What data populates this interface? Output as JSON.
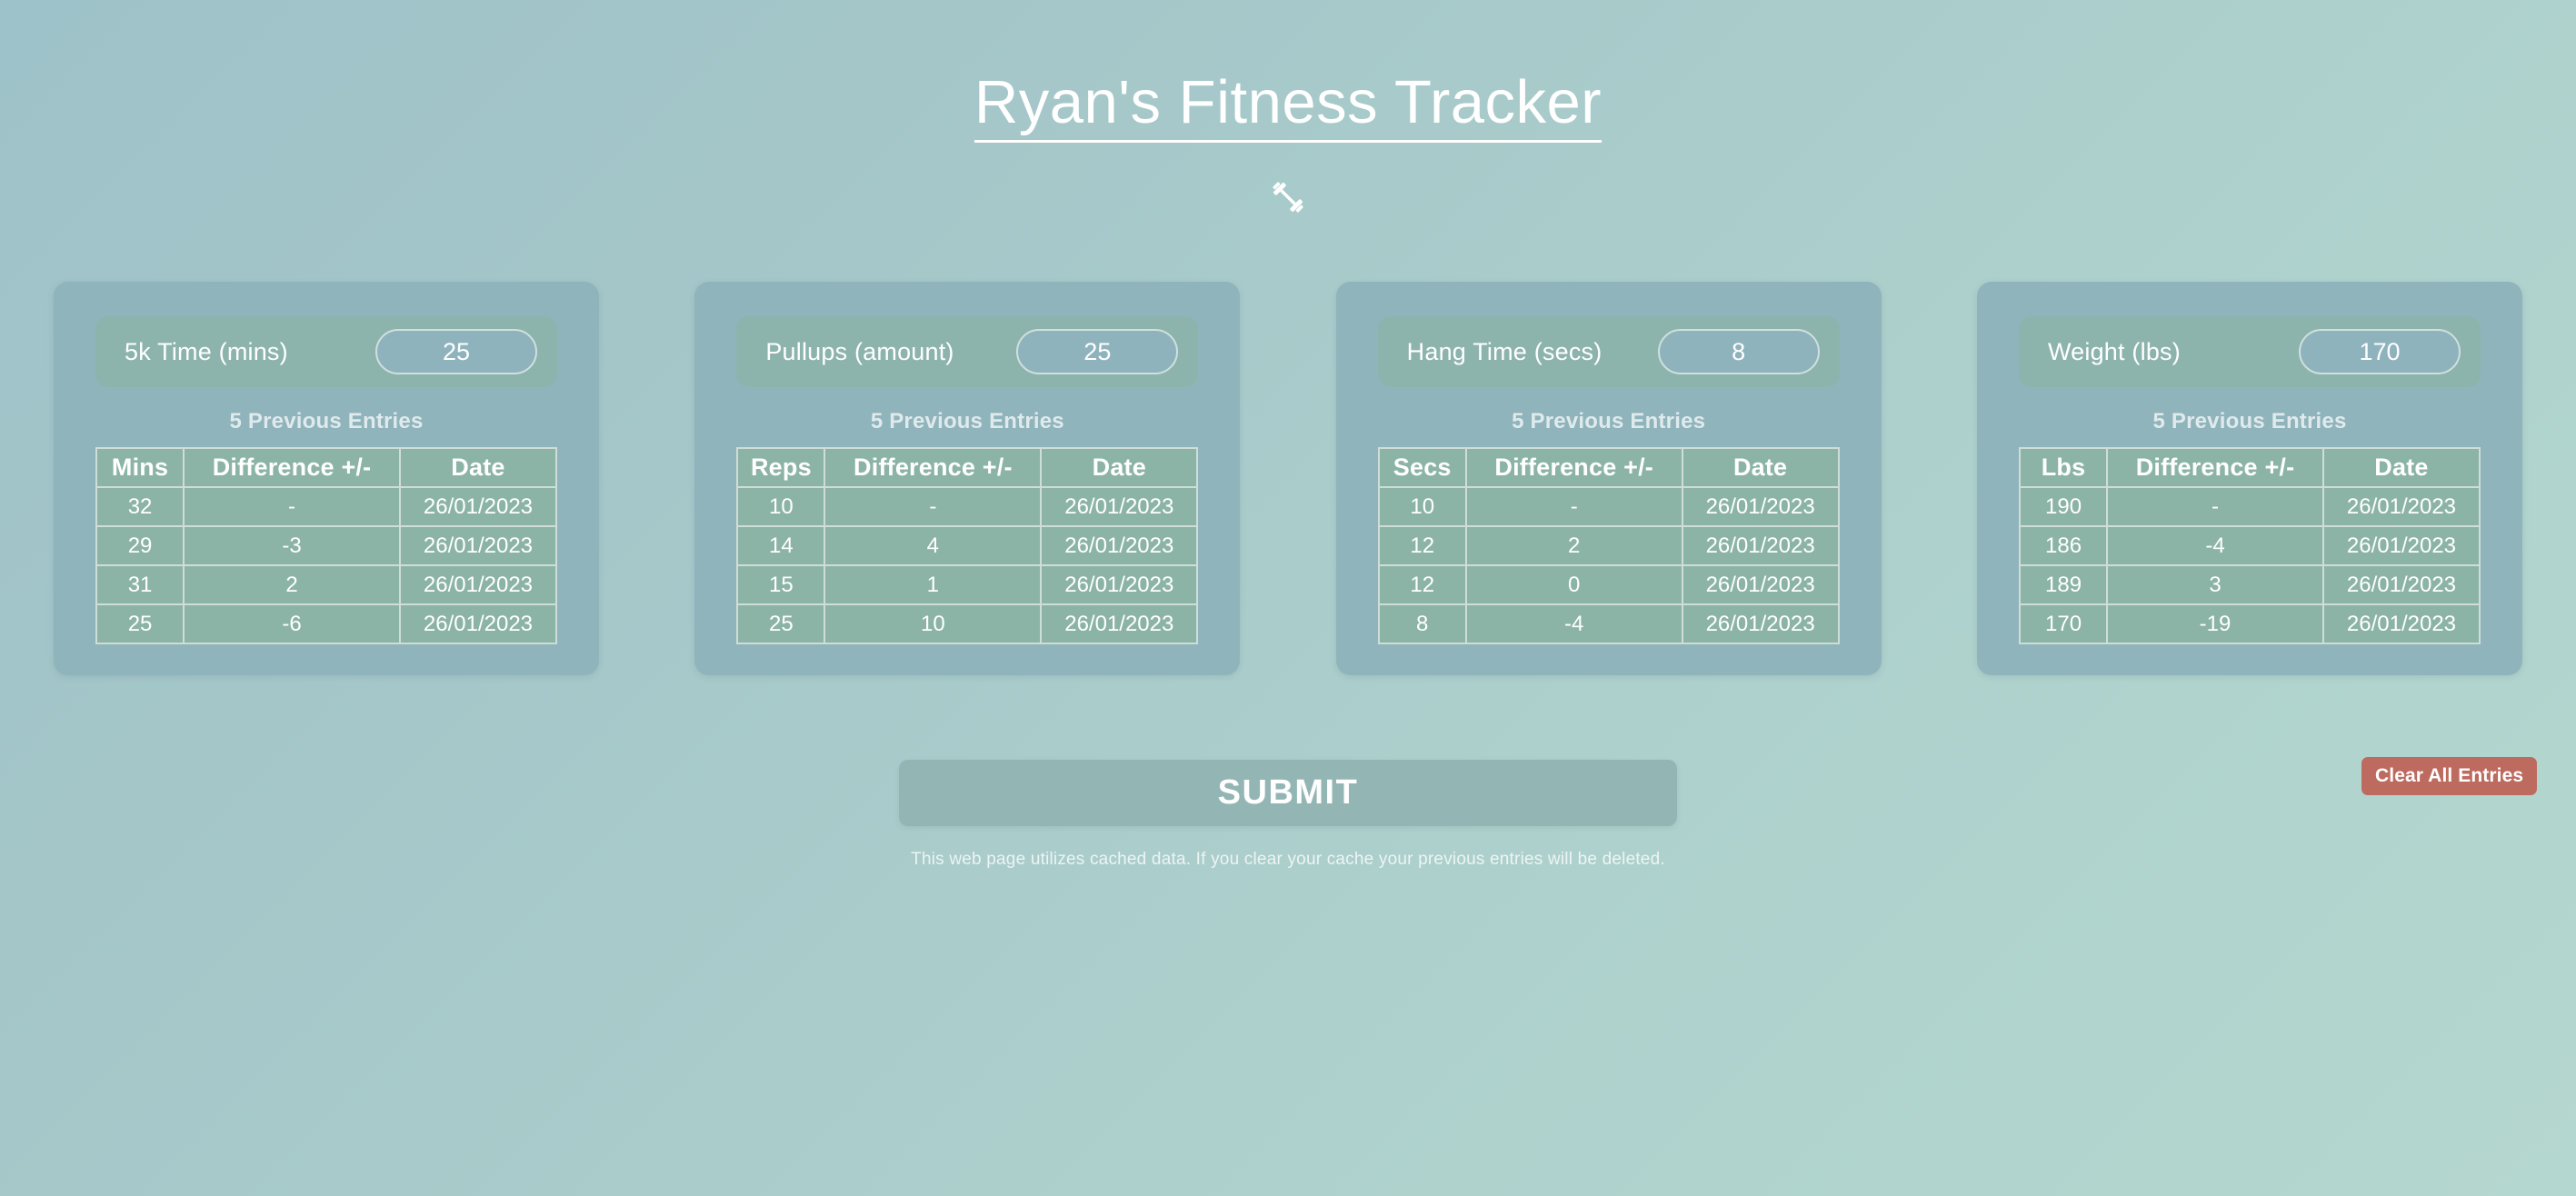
{
  "header": {
    "title": "Ryan's Fitness Tracker",
    "icon": "dumbbell-icon"
  },
  "cards": [
    {
      "label": "5k Time (mins)",
      "input_value": "25",
      "entries_caption": "5 Previous Entries",
      "columns": [
        "Mins",
        "Difference +/-",
        "Date"
      ],
      "rows": [
        [
          "32",
          "-",
          "26/01/2023"
        ],
        [
          "29",
          "-3",
          "26/01/2023"
        ],
        [
          "31",
          "2",
          "26/01/2023"
        ],
        [
          "25",
          "-6",
          "26/01/2023"
        ]
      ]
    },
    {
      "label": "Pullups (amount)",
      "input_value": "25",
      "entries_caption": "5 Previous Entries",
      "columns": [
        "Reps",
        "Difference +/-",
        "Date"
      ],
      "rows": [
        [
          "10",
          "-",
          "26/01/2023"
        ],
        [
          "14",
          "4",
          "26/01/2023"
        ],
        [
          "15",
          "1",
          "26/01/2023"
        ],
        [
          "25",
          "10",
          "26/01/2023"
        ]
      ]
    },
    {
      "label": "Hang Time (secs)",
      "input_value": "8",
      "entries_caption": "5 Previous Entries",
      "columns": [
        "Secs",
        "Difference +/-",
        "Date"
      ],
      "rows": [
        [
          "10",
          "-",
          "26/01/2023"
        ],
        [
          "12",
          "2",
          "26/01/2023"
        ],
        [
          "12",
          "0",
          "26/01/2023"
        ],
        [
          "8",
          "-4",
          "26/01/2023"
        ]
      ]
    },
    {
      "label": "Weight (lbs)",
      "input_value": "170",
      "entries_caption": "5 Previous Entries",
      "columns": [
        "Lbs",
        "Difference +/-",
        "Date"
      ],
      "rows": [
        [
          "190",
          "-",
          "26/01/2023"
        ],
        [
          "186",
          "-4",
          "26/01/2023"
        ],
        [
          "189",
          "3",
          "26/01/2023"
        ],
        [
          "170",
          "-19",
          "26/01/2023"
        ]
      ]
    }
  ],
  "actions": {
    "submit_label": "SUBMIT",
    "clear_label": "Clear All Entries",
    "cache_note": "This web page utilizes cached data. If you clear your cache your previous entries will be deleted."
  },
  "colors": {
    "background_start": "#9ec2c9",
    "background_end": "#b4d7cf",
    "card": "#8fb4bc",
    "card_head": "#8cb4ad",
    "input": "#8fb3bd",
    "table_cell": "#8cb4a6",
    "table_border": "#cfddd8",
    "submit": "#93b6b5",
    "clear": "#bd6a5f",
    "text": "#ffffff"
  }
}
